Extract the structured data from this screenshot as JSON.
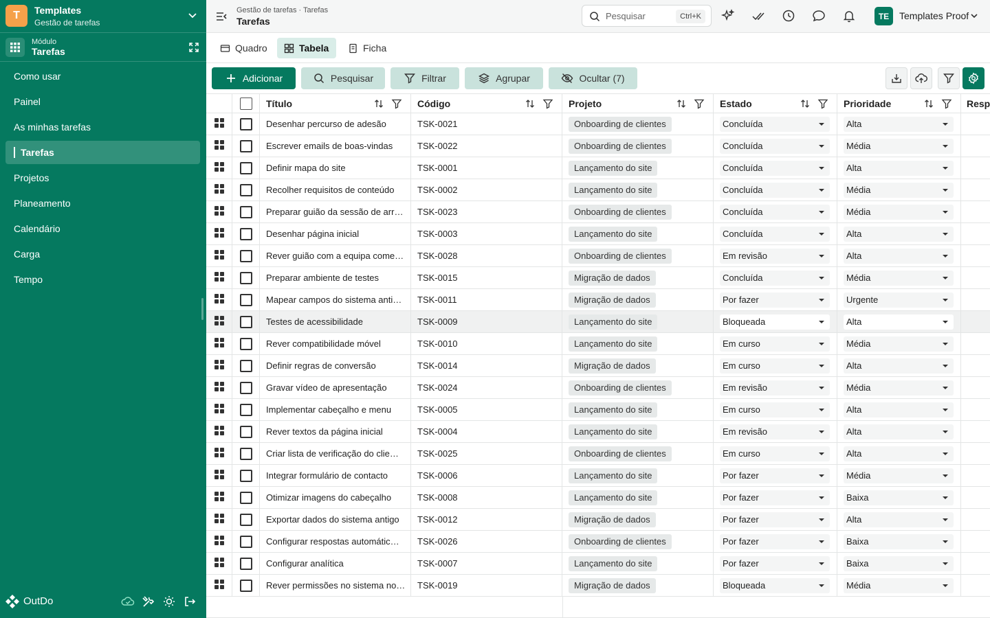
{
  "workspace": {
    "logo_letter": "T",
    "title": "Templates",
    "subtitle": "Gestão de tarefas"
  },
  "module": {
    "label": "Módulo",
    "name": "Tarefas"
  },
  "nav": {
    "items": [
      {
        "label": "Como usar",
        "active": false
      },
      {
        "label": "Painel",
        "active": false
      },
      {
        "label": "As minhas tarefas",
        "active": false
      },
      {
        "label": "Tarefas",
        "active": true
      },
      {
        "label": "Projetos",
        "active": false
      },
      {
        "label": "Planeamento",
        "active": false
      },
      {
        "label": "Calendário",
        "active": false
      },
      {
        "label": "Carga",
        "active": false
      },
      {
        "label": "Tempo",
        "active": false
      }
    ]
  },
  "footer": {
    "brand": "OutDo",
    "icons": [
      "cloud-check-icon",
      "tools-icon",
      "sun-icon",
      "logout-icon"
    ]
  },
  "topbar": {
    "breadcrumb": "Gestão de tarefas · Tarefas",
    "title": "Tarefas",
    "search_placeholder": "Pesquisar",
    "search_shortcut": "Ctrl+K",
    "icons": [
      "sparkles-icon",
      "double-check-icon",
      "clock-icon",
      "chat-icon",
      "bell-icon"
    ],
    "user_initials": "TE",
    "user_name": "Templates Proof"
  },
  "views": {
    "tabs": [
      {
        "label": "Quadro"
      },
      {
        "label": "Tabela",
        "active": true
      },
      {
        "label": "Ficha"
      }
    ]
  },
  "toolbar": {
    "add": "Adicionar",
    "search": "Pesquisar",
    "filter": "Filtrar",
    "group": "Agrupar",
    "hide": "Ocultar (7)"
  },
  "table": {
    "columns": [
      "Título",
      "Código",
      "Projeto",
      "Estado",
      "Prioridade",
      "Respo"
    ],
    "rows": [
      {
        "title": "Desenhar percurso de adesão",
        "code": "TSK-0021",
        "project": "Onboarding de clientes",
        "state": "Concluída",
        "priority": "Alta"
      },
      {
        "title": "Escrever emails de boas-vindas",
        "code": "TSK-0022",
        "project": "Onboarding de clientes",
        "state": "Concluída",
        "priority": "Média"
      },
      {
        "title": "Definir mapa do site",
        "code": "TSK-0001",
        "project": "Lançamento do site",
        "state": "Concluída",
        "priority": "Alta"
      },
      {
        "title": "Recolher requisitos de conteúdo",
        "code": "TSK-0002",
        "project": "Lançamento do site",
        "state": "Concluída",
        "priority": "Média"
      },
      {
        "title": "Preparar guião da sessão de arr…",
        "code": "TSK-0023",
        "project": "Onboarding de clientes",
        "state": "Concluída",
        "priority": "Média"
      },
      {
        "title": "Desenhar página inicial",
        "code": "TSK-0003",
        "project": "Lançamento do site",
        "state": "Concluída",
        "priority": "Alta"
      },
      {
        "title": "Rever guião com a equipa come…",
        "code": "TSK-0028",
        "project": "Onboarding de clientes",
        "state": "Em revisão",
        "priority": "Alta"
      },
      {
        "title": "Preparar ambiente de testes",
        "code": "TSK-0015",
        "project": "Migração de dados",
        "state": "Concluída",
        "priority": "Média"
      },
      {
        "title": "Mapear campos do sistema anti…",
        "code": "TSK-0011",
        "project": "Migração de dados",
        "state": "Por fazer",
        "priority": "Urgente"
      },
      {
        "title": "Testes de acessibilidade",
        "code": "TSK-0009",
        "project": "Lançamento do site",
        "state": "Bloqueada",
        "priority": "Alta",
        "highlight": true
      },
      {
        "title": "Rever compatibilidade móvel",
        "code": "TSK-0010",
        "project": "Lançamento do site",
        "state": "Em curso",
        "priority": "Média"
      },
      {
        "title": "Definir regras de conversão",
        "code": "TSK-0014",
        "project": "Migração de dados",
        "state": "Em curso",
        "priority": "Alta"
      },
      {
        "title": "Gravar vídeo de apresentação",
        "code": "TSK-0024",
        "project": "Onboarding de clientes",
        "state": "Em revisão",
        "priority": "Média"
      },
      {
        "title": "Implementar cabeçalho e menu",
        "code": "TSK-0005",
        "project": "Lançamento do site",
        "state": "Em curso",
        "priority": "Alta"
      },
      {
        "title": "Rever textos da página inicial",
        "code": "TSK-0004",
        "project": "Lançamento do site",
        "state": "Em revisão",
        "priority": "Alta"
      },
      {
        "title": "Criar lista de verificação do clie…",
        "code": "TSK-0025",
        "project": "Onboarding de clientes",
        "state": "Em curso",
        "priority": "Alta"
      },
      {
        "title": "Integrar formulário de contacto",
        "code": "TSK-0006",
        "project": "Lançamento do site",
        "state": "Por fazer",
        "priority": "Média"
      },
      {
        "title": "Otimizar imagens do cabeçalho",
        "code": "TSK-0008",
        "project": "Lançamento do site",
        "state": "Por fazer",
        "priority": "Baixa"
      },
      {
        "title": "Exportar dados do sistema antigo",
        "code": "TSK-0012",
        "project": "Migração de dados",
        "state": "Por fazer",
        "priority": "Alta"
      },
      {
        "title": "Configurar respostas automátic…",
        "code": "TSK-0026",
        "project": "Onboarding de clientes",
        "state": "Por fazer",
        "priority": "Baixa"
      },
      {
        "title": "Configurar analítica",
        "code": "TSK-0007",
        "project": "Lançamento do site",
        "state": "Por fazer",
        "priority": "Baixa"
      },
      {
        "title": "Rever permissões no sistema no…",
        "code": "TSK-0019",
        "project": "Migração de dados",
        "state": "Bloqueada",
        "priority": "Média"
      }
    ]
  },
  "colors": {
    "brand": "#05795f",
    "logo": "#f5a14a",
    "soft_button": "#c9e2dc",
    "active_tab": "#d9ede8"
  }
}
